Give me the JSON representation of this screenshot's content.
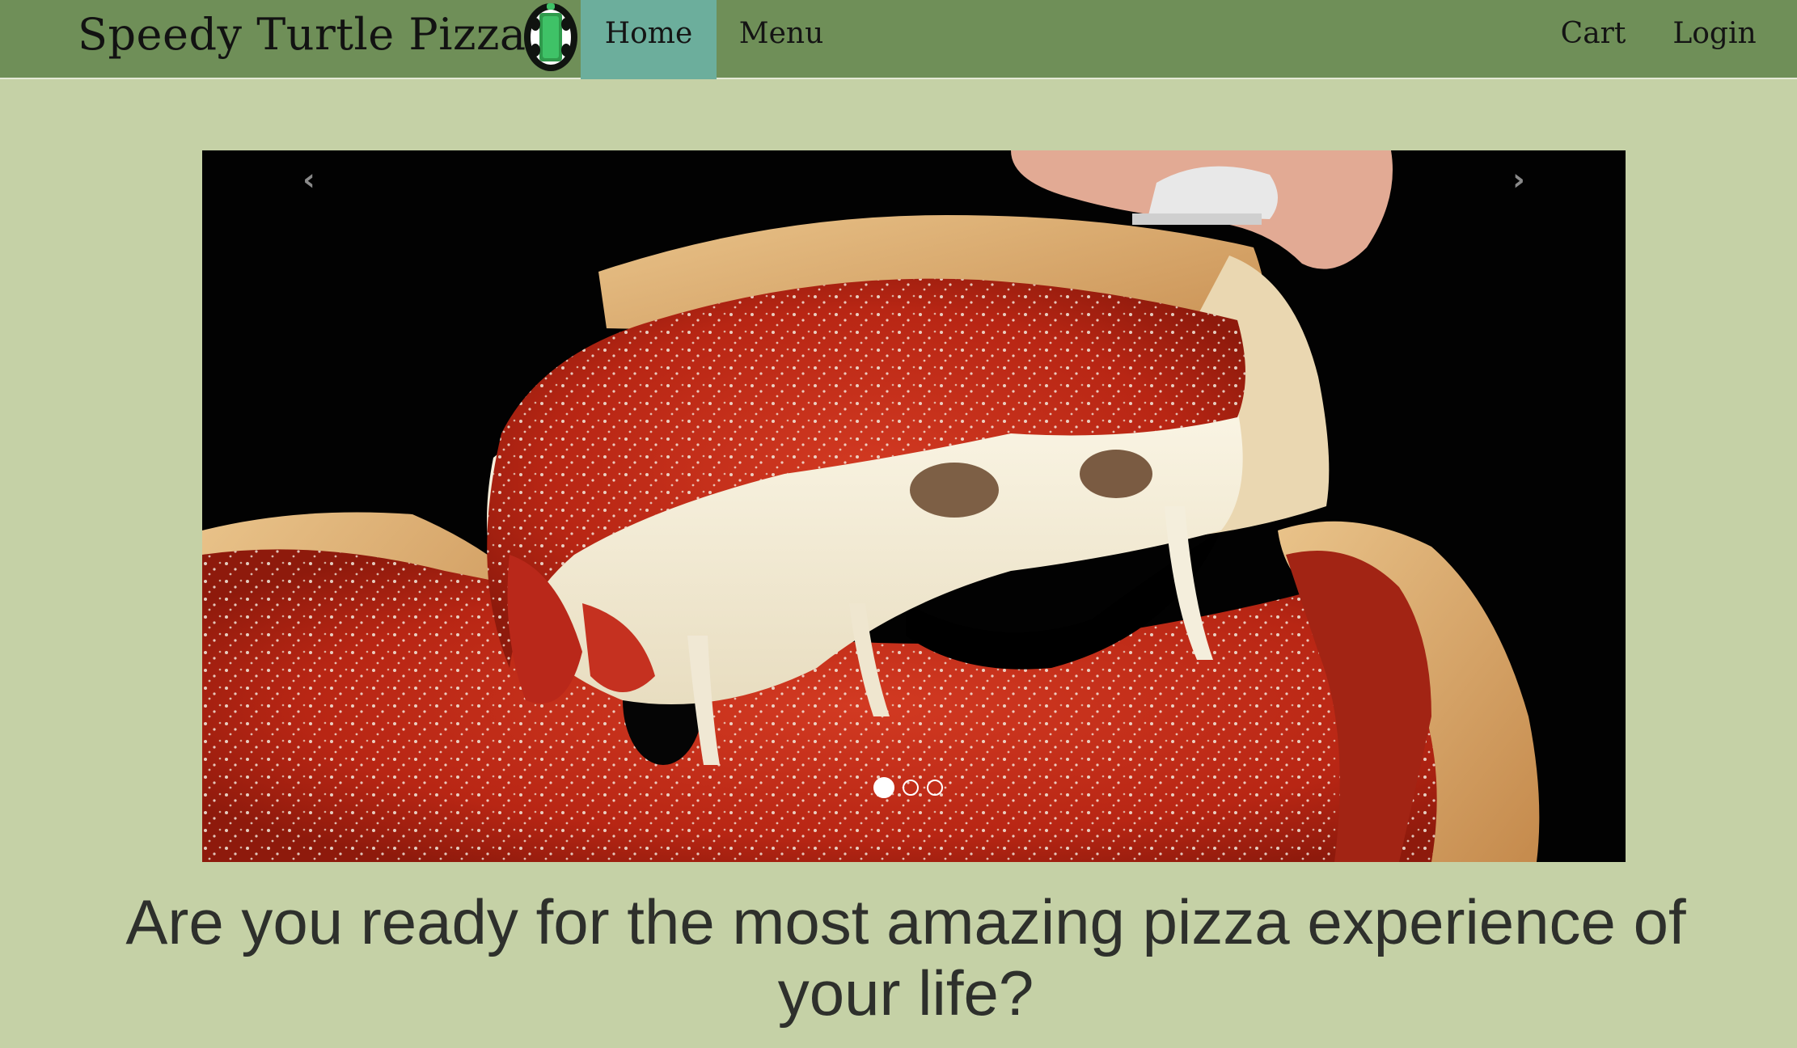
{
  "navbar": {
    "brand": "Speedy Turtle Pizza",
    "logo_icon": "turtle-logo-icon",
    "links": {
      "home": "Home",
      "menu": "Menu",
      "cart": "Cart",
      "login": "Login"
    },
    "active_link": "Home"
  },
  "carousel": {
    "prev_arrow": "‹",
    "next_arrow": "›",
    "slide_count": 3,
    "active_slide": 1,
    "slide_image": "deep-dish-pizza-photo"
  },
  "hero": {
    "headline": "Are you ready for the most amazing pizza experience of your life?"
  },
  "colors": {
    "page_background": "#c5d1a6",
    "navbar_background": "#6f8f58",
    "active_tab": "#6cae9c",
    "headline_text": "#2e302c"
  }
}
